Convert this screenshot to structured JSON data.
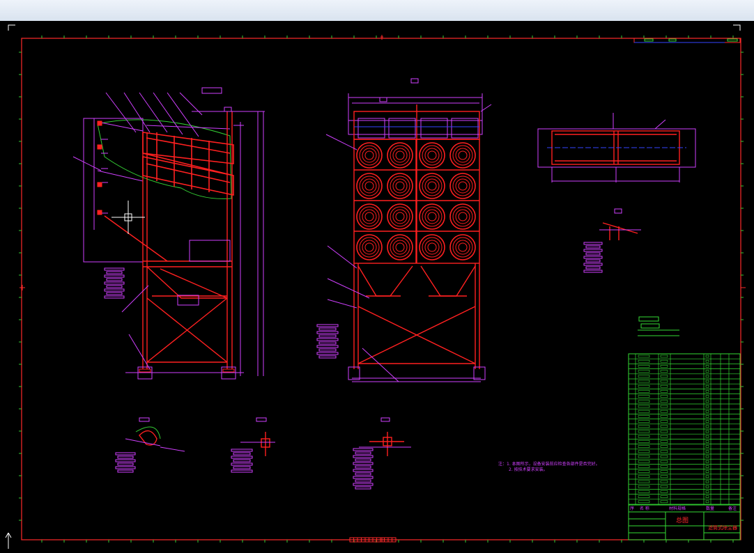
{
  "window": {
    "title": ""
  },
  "drawing": {
    "colors": {
      "background": "#000000",
      "frame": "#ff2a2a",
      "structure": "#ff2020",
      "dimension": "#d040ff",
      "table": "#33dd33",
      "tick": "#33cc33",
      "cursor": "#ffffff",
      "centerline": "#3344ff"
    },
    "notes": {
      "line1": "注：1. 本图所示，设备安装前应检查各部件是否完好。",
      "line2": "2. 按技术要求安装。"
    },
    "title_block": {
      "title": "总图",
      "name": "滤筒式除尘器",
      "headers": [
        "序",
        "名 称",
        "材料规格",
        "数量",
        "备注"
      ]
    },
    "cursor": {
      "shape": "crosshair"
    }
  }
}
